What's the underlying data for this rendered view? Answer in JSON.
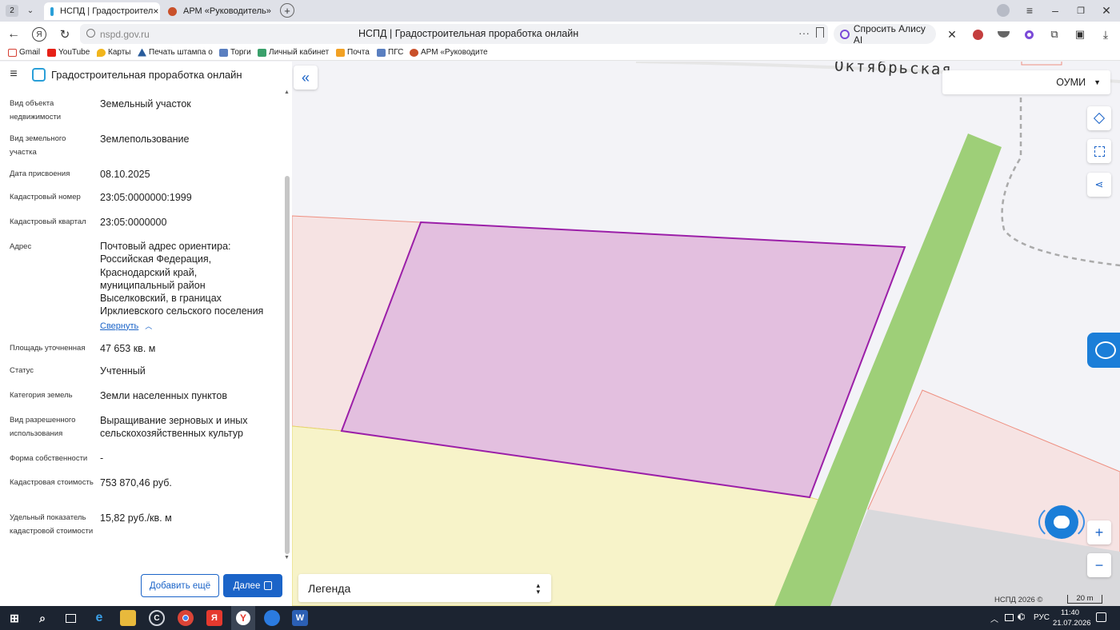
{
  "browser": {
    "tab_count": "2",
    "tabs": [
      {
        "title": "НСПД | Градостроител"
      },
      {
        "title": "АРМ «Руководитель»"
      }
    ],
    "url": "nspd.gov.ru",
    "page_title": "НСПД | Градостроительная проработка онлайн",
    "alice_label": "Спросить Алису AI",
    "bookmarks": [
      "Gmail",
      "YouTube",
      "Карты",
      "Печать штампа о",
      "Торги",
      "Личный кабинет",
      "Почта",
      "ПГС",
      "АРМ «Руководите"
    ]
  },
  "app": {
    "title": "Градостроительная проработка онлайн"
  },
  "properties": [
    {
      "label": "Вид объекта недвижимости",
      "value": "Земельный участок"
    },
    {
      "label": "Вид земельного участка",
      "value": "Землепользование"
    },
    {
      "label": "Дата присвоения",
      "value": "08.10.2025"
    },
    {
      "label": "Кадастровый номер",
      "value": "23:05:0000000:1999"
    },
    {
      "label": "Кадастровый квартал",
      "value": "23:05:0000000"
    },
    {
      "label": "Адрес",
      "value": "Почтовый адрес ориентира: Российская Федерация, Краснодарский край, муниципальный район Выселковский, в границах Ирклиевского сельского поселения"
    },
    {
      "label": "Площадь уточненная",
      "value": "47 653 кв. м"
    },
    {
      "label": "Статус",
      "value": "Учтенный"
    },
    {
      "label": "Категория земель",
      "value": "Земли населенных пунктов"
    },
    {
      "label": "Вид разрешенного использования",
      "value": "Выращивание зерновых и иных сельскохозяйственных культур"
    },
    {
      "label": "Форма собственности",
      "value": "-"
    },
    {
      "label": "Кадастровая стоимость",
      "value": "753 870,46 руб."
    },
    {
      "label": "Удельный показатель кадастровой стоимости",
      "value": "15,82 руб./кв. м"
    }
  ],
  "collapse_link": "Свернуть",
  "buttons": {
    "add_more": "Добавить ещё",
    "next": "Далее"
  },
  "map": {
    "street_label": "Октябрьская",
    "layer_select": "ОУМИ",
    "legend": "Легенда",
    "copyright": "НСПД 2026 ©",
    "scale": "20 m",
    "colors": {
      "selected_fill": "#e3bfdf",
      "selected_stroke": "#9b1fa8",
      "green_strip": "#9ecf78",
      "yellow_zone": "#f7f3c9",
      "pink_zone": "#f6e3e3",
      "gray_zone": "#d9d9dc"
    }
  },
  "taskbar": {
    "lang": "РУС",
    "time": "11:40",
    "date": "21.07.2026"
  }
}
